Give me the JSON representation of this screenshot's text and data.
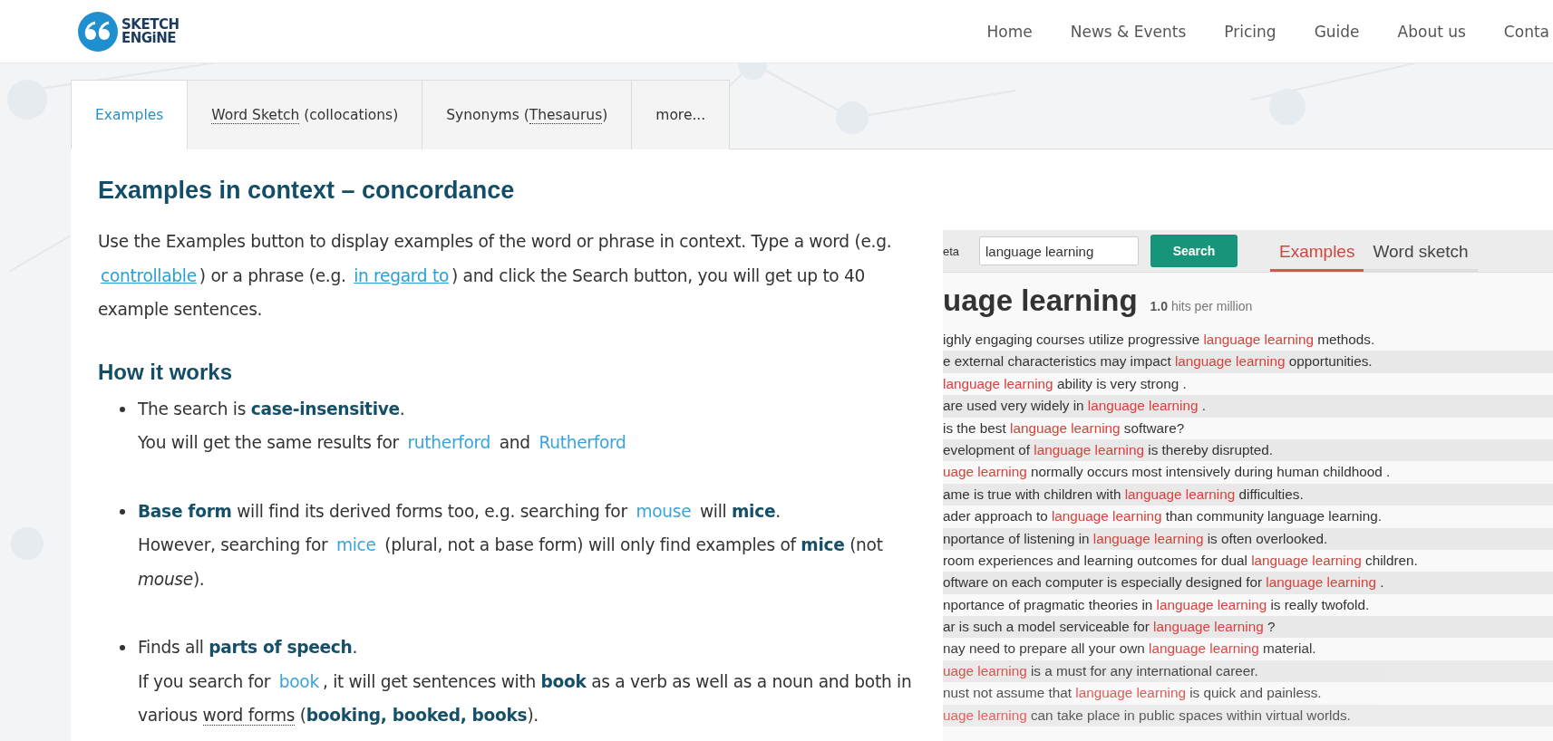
{
  "header": {
    "logo": [
      "SKETCH",
      "ENGiNE"
    ],
    "nav": [
      "Home",
      "News & Events",
      "Pricing",
      "Guide",
      "About us",
      "Conta"
    ]
  },
  "tabs": [
    {
      "parts": [
        {
          "kind": "plain",
          "text": "Examples"
        }
      ],
      "selected": true
    },
    {
      "parts": [
        {
          "kind": "dotted",
          "text": "Word Sketch"
        },
        {
          "kind": "plain",
          "text": " (collocations)"
        }
      ],
      "selected": false
    },
    {
      "parts": [
        {
          "kind": "plain",
          "text": "Synonyms ("
        },
        {
          "kind": "dotted",
          "text": "Thesaurus"
        },
        {
          "kind": "plain",
          "text": ")"
        }
      ],
      "selected": false
    },
    {
      "parts": [
        {
          "kind": "plain",
          "text": "more..."
        }
      ],
      "selected": false
    }
  ],
  "article": {
    "title": "Examples in context – concordance",
    "intro": [
      {
        "kind": "plain",
        "text": "Use the Examples button to display examples of the word or phrase in context. Type a word (e.g. "
      },
      {
        "kind": "link",
        "text": "controllable"
      },
      {
        "kind": "plain",
        "text": ") or a phrase (e.g. "
      },
      {
        "kind": "link",
        "text": "in regard to"
      },
      {
        "kind": "plain",
        "text": ") and click the Search button, you will get up to 40 example sentences."
      }
    ],
    "subtitle": "How it works",
    "bullets": [
      {
        "lines": [
          [
            {
              "kind": "plain",
              "text": "The search is "
            },
            {
              "kind": "bold",
              "text": "case-insensitive"
            },
            {
              "kind": "plain",
              "text": "."
            }
          ],
          [
            {
              "kind": "plain",
              "text": "You will get the same results for "
            },
            {
              "kind": "term",
              "text": "rutherford"
            },
            {
              "kind": "plain",
              "text": " and "
            },
            {
              "kind": "term",
              "text": "Rutherford"
            }
          ]
        ]
      },
      {
        "lines": [
          [
            {
              "kind": "bold",
              "text": "Base form"
            },
            {
              "kind": "plain",
              "text": " will find its derived forms too, e.g. searching for "
            },
            {
              "kind": "term",
              "text": "mouse"
            },
            {
              "kind": "plain",
              "text": " will "
            },
            {
              "kind": "bold",
              "text": "mice"
            },
            {
              "kind": "plain",
              "text": "."
            }
          ],
          [
            {
              "kind": "plain",
              "text": "However, searching for "
            },
            {
              "kind": "term",
              "text": "mice"
            },
            {
              "kind": "plain",
              "text": " (plural, not a base form) will only find examples of "
            },
            {
              "kind": "bold",
              "text": "mice"
            },
            {
              "kind": "plain",
              "text": " (not "
            },
            {
              "kind": "italic",
              "text": "mouse"
            },
            {
              "kind": "plain",
              "text": ")."
            }
          ]
        ]
      },
      {
        "lines": [
          [
            {
              "kind": "plain",
              "text": "Finds all "
            },
            {
              "kind": "bold",
              "text": "parts of speech"
            },
            {
              "kind": "plain",
              "text": "."
            }
          ],
          [
            {
              "kind": "plain",
              "text": "If you search for "
            },
            {
              "kind": "term",
              "text": "book"
            },
            {
              "kind": "plain",
              "text": ", it will get sentences with "
            },
            {
              "kind": "bold",
              "text": "book"
            },
            {
              "kind": "plain",
              "text": " as a verb as well as a noun and both in various "
            },
            {
              "kind": "dotted",
              "text": "word forms"
            },
            {
              "kind": "plain",
              "text": " ("
            },
            {
              "kind": "bold",
              "text": "booking, booked, books"
            },
            {
              "kind": "plain",
              "text": ")."
            }
          ]
        ]
      }
    ]
  },
  "concordance": {
    "corner_text": "eta",
    "search_value": "language learning",
    "search_button": "Search",
    "tabs": [
      {
        "label": "Examples",
        "selected": true
      },
      {
        "label": "Word sketch",
        "selected": false
      }
    ],
    "heading": "uage learning",
    "frequency": "**1.0** hits per million",
    "lines": [
      {
        "left": "ighly engaging courses utilize progressive",
        "kwic": "language learning",
        "right": "methods."
      },
      {
        "left": "e external characteristics may impact",
        "kwic": "language learning",
        "right": "opportunities."
      },
      {
        "kwic": "language learning",
        "right": "ability is very strong ."
      },
      {
        "left": "are used very widely in",
        "kwic": "language learning",
        "right": "."
      },
      {
        "left": "is the best",
        "kwic": "language learning",
        "right": "software?"
      },
      {
        "left": "evelopment of",
        "kwic": "language learning",
        "right": "is thereby disrupted."
      },
      {
        "kwic": "uage learning",
        "right": "normally occurs most intensively during human childhood ."
      },
      {
        "left": "ame is true with children with",
        "kwic": "language learning",
        "right": "difficulties."
      },
      {
        "left": "ader approach to",
        "kwic": "language learning",
        "right": "than community language learning."
      },
      {
        "left": "nportance of listening in",
        "kwic": "language learning",
        "right": "is often overlooked."
      },
      {
        "left": "room experiences and learning outcomes for dual",
        "kwic": "language learning",
        "right": "children."
      },
      {
        "left": "oftware on each computer is especially designed for",
        "kwic": "language learning",
        "right": "."
      },
      {
        "left": "nportance of pragmatic theories in",
        "kwic": "language learning",
        "right": "is really twofold."
      },
      {
        "left": "ar is such a model serviceable for",
        "kwic": "language learning",
        "right": "?"
      },
      {
        "left": "nay need to prepare all your own",
        "kwic": "language learning",
        "right": "material."
      },
      {
        "kwic": "uage learning",
        "right": "is a must for any international career."
      },
      {
        "left": "nust not assume that",
        "kwic": "language learning",
        "right": "is quick and painless."
      },
      {
        "kwic": "uage learning",
        "right": "can take place in public spaces within virtual worlds."
      }
    ]
  }
}
